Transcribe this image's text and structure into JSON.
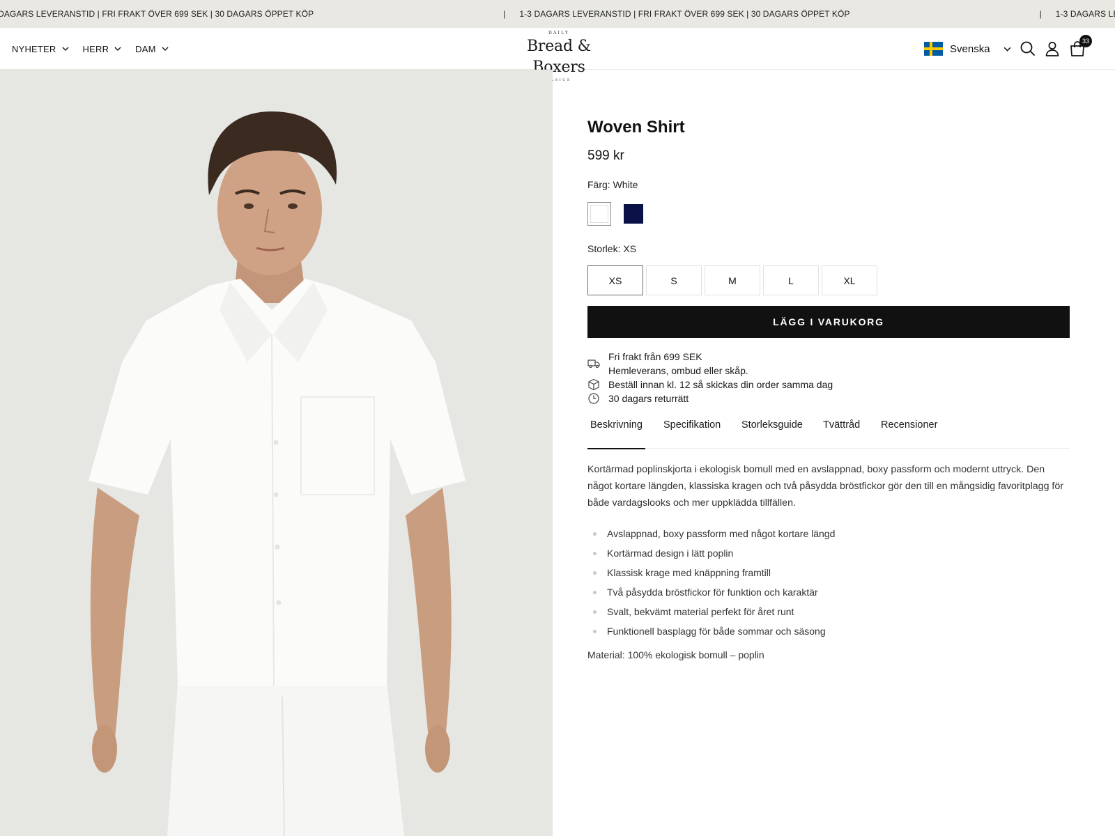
{
  "announcement": {
    "message": "1-3 DAGARS LEVERANSTID | FRI FRAKT ÖVER 699 SEK | 30 DAGARS ÖPPET KÖP",
    "separator": "|"
  },
  "header": {
    "nav": [
      {
        "label": "NYHETER"
      },
      {
        "label": "HERR"
      },
      {
        "label": "DAM"
      }
    ],
    "logo": {
      "top": "DAILY",
      "main": "Bread & Boxers",
      "bottom": "BASICS"
    },
    "language": {
      "label": "Svenska",
      "flag": "sweden-flag"
    },
    "cart_count": "33",
    "icons": [
      "search-icon",
      "account-icon",
      "cart-icon"
    ]
  },
  "product": {
    "title": "Woven Shirt",
    "price": "599 kr",
    "color_label": "Färg:",
    "color_value": "White",
    "colors": [
      {
        "name": "White",
        "hex": "#ffffff",
        "selected": true
      },
      {
        "name": "Navy",
        "hex": "#0b1248",
        "selected": false
      }
    ],
    "size_label": "Storlek:",
    "size_value": "XS",
    "sizes": [
      "XS",
      "S",
      "M",
      "L",
      "XL"
    ],
    "add_to_cart": "LÄGG I VARUKORG",
    "perks": [
      {
        "icon": "truck-icon",
        "lines": [
          "Fri frakt från 699 SEK",
          "Hemleverans, ombud eller skåp."
        ]
      },
      {
        "icon": "box-icon",
        "lines": [
          "Beställ innan kl. 12 så skickas din order samma dag"
        ]
      },
      {
        "icon": "clock-icon",
        "lines": [
          "30 dagars returrätt"
        ]
      }
    ],
    "tabs": [
      "Beskrivning",
      "Specifikation",
      "Storleksguide",
      "Tvättråd",
      "Recensioner"
    ],
    "active_tab": "Beskrivning",
    "description": "Kortärmad poplinskjorta i ekologisk bomull med en avslappnad, boxy passform och modernt uttryck. Den något kortare längden, klassiska kragen och två påsydda bröstfickor gör den till en mångsidig favoritplagg för både vardagslooks och mer uppklädda tillfällen.",
    "bullets": [
      "Avslappnad, boxy passform med något kortare längd",
      "Kortärmad design i lätt poplin",
      "Klassisk krage med knäppning framtill",
      "Två påsydda bröstfickor för funktion och karaktär",
      "Svalt, bekvämt material perfekt för året runt",
      "Funktionell basplagg för både sommar och säsong"
    ],
    "material": "Material: 100% ekologisk bomull – poplin"
  },
  "colors": {
    "announcement_bg": "#e9e8e3",
    "button_bg": "#111111",
    "gallery_bg": "#e6e6e2"
  }
}
